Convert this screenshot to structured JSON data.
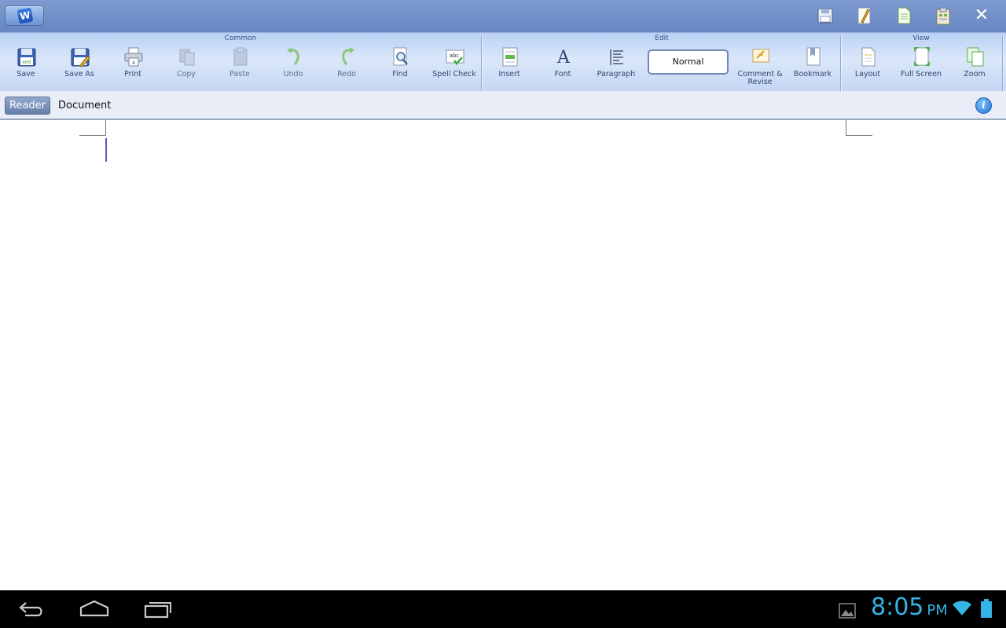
{
  "app": {
    "logo_letter": "W"
  },
  "ribbon": {
    "groups": {
      "common": "Common",
      "edit": "Edit",
      "view": "View"
    },
    "buttons": {
      "save": "Save",
      "save_as": "Save As",
      "print": "Print",
      "copy": "Copy",
      "paste": "Paste",
      "undo": "Undo",
      "redo": "Redo",
      "find": "Find",
      "spell_check": "Spell Check",
      "insert": "Insert",
      "font": "Font",
      "paragraph": "Paragraph",
      "comment_revise_line1": "Comment &",
      "comment_revise_line2": "Revise",
      "bookmark": "Bookmark",
      "layout": "Layout",
      "full_screen": "Full Screen",
      "zoom": "Zoom"
    },
    "style_value": "Normal"
  },
  "tabbar": {
    "reader_label": "Reader",
    "document_title": "Document",
    "info_glyph": "i"
  },
  "statusbar": {
    "time": "8:05",
    "ampm": "PM"
  },
  "colors": {
    "accent": "#33b5e5",
    "ribbon": "#c4d6f3",
    "titlebar": "#7290c9"
  }
}
